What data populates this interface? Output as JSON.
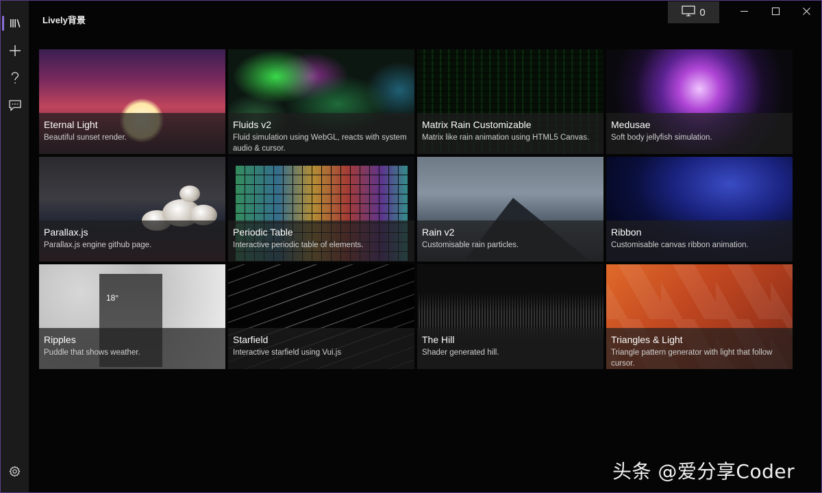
{
  "app": {
    "title": "Lively背景"
  },
  "sidebar": {
    "items": [
      {
        "name": "library",
        "icon": "library-icon"
      },
      {
        "name": "add",
        "icon": "plus-icon"
      },
      {
        "name": "help",
        "icon": "help-icon"
      },
      {
        "name": "feedback",
        "icon": "chat-icon"
      }
    ],
    "settings_icon": "gear-icon"
  },
  "titlebar": {
    "display_count": "0",
    "display_icon": "monitor-icon"
  },
  "wallpapers": [
    {
      "title": "Eternal Light",
      "description": "Beautiful sunset render."
    },
    {
      "title": "Fluids v2",
      "description": "Fluid simulation using WebGL, reacts with system audio & cursor."
    },
    {
      "title": "Matrix Rain Customizable",
      "description": "Matrix like rain animation using HTML5 Canvas."
    },
    {
      "title": "Medusae",
      "description": "Soft body jellyfish simulation."
    },
    {
      "title": "Parallax.js",
      "description": "Parallax.js engine github page."
    },
    {
      "title": "Periodic Table",
      "description": "Interactive periodic table of elements."
    },
    {
      "title": "Rain v2",
      "description": "Customisable rain particles."
    },
    {
      "title": "Ribbon",
      "description": "Customisable canvas ribbon animation."
    },
    {
      "title": "Ripples",
      "description": "Puddle that shows weather."
    },
    {
      "title": "Starfield",
      "description": "Interactive starfield using Vui.js"
    },
    {
      "title": "The Hill",
      "description": "Shader generated hill."
    },
    {
      "title": "Triangles & Light",
      "description": "Triangle pattern generator with light that follow cursor."
    }
  ],
  "weather_card": {
    "temperature": "18°"
  },
  "watermark": {
    "text": "头条 @爱分享Coder"
  },
  "colors": {
    "accent": "#8a6fd6",
    "sidebar": "#1b1b1b",
    "background": "#050505"
  }
}
